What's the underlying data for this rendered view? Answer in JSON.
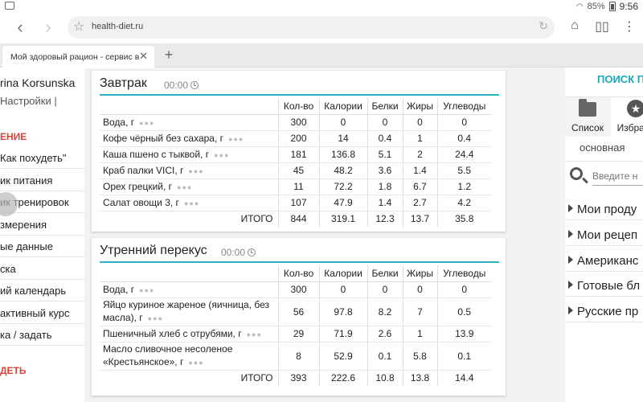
{
  "status": {
    "battery": "85%",
    "time": "9:56"
  },
  "browser": {
    "url": "health-diet.ru",
    "tab_title": "Мой здоровый рацион - сервис в...",
    "tab_close": "✕",
    "new_tab": "+"
  },
  "left": {
    "user": "rina Korsunska",
    "settings": "Настройки |",
    "section1": "ЕНИЕ",
    "items": [
      "Как похудеть\"",
      "ик питания",
      "ик тренировок",
      "змерения",
      "ые данные",
      "ска",
      "ий календарь",
      "активный курс",
      "ка / задать"
    ],
    "section2": "ДЕТЬ"
  },
  "table_headers": {
    "name": "",
    "qty": "Кол-во",
    "cal": "Калории",
    "prot": "Белки",
    "fat": "Жиры",
    "carb": "Углеводы"
  },
  "breakfast": {
    "title": "Завтрак",
    "time": "00:00",
    "rows": [
      {
        "name": "Вода, г",
        "qty": "300",
        "cal": "0",
        "prot": "0",
        "fat": "0",
        "carb": "0"
      },
      {
        "name": "Кофе чёрный без сахара, г",
        "qty": "200",
        "cal": "14",
        "prot": "0.4",
        "fat": "1",
        "carb": "0.4"
      },
      {
        "name": "Каша пшено с тыквой, г",
        "qty": "181",
        "cal": "136.8",
        "prot": "5.1",
        "fat": "2",
        "carb": "24.4"
      },
      {
        "name": "Краб палки VICI, г",
        "qty": "45",
        "cal": "48.2",
        "prot": "3.6",
        "fat": "1.4",
        "carb": "5.5"
      },
      {
        "name": "Орех грецкий, г",
        "qty": "11",
        "cal": "72.2",
        "prot": "1.8",
        "fat": "6.7",
        "carb": "1.2"
      },
      {
        "name": "Салат овощи 3, г",
        "qty": "107",
        "cal": "47.9",
        "prot": "1.4",
        "fat": "2.7",
        "carb": "4.2"
      }
    ],
    "total": {
      "label": "ИТОГО",
      "qty": "844",
      "cal": "319.1",
      "prot": "12.3",
      "fat": "13.7",
      "carb": "35.8"
    }
  },
  "snack": {
    "title": "Утренний перекус",
    "time": "00:00",
    "rows": [
      {
        "name": "Вода, г",
        "qty": "300",
        "cal": "0",
        "prot": "0",
        "fat": "0",
        "carb": "0"
      },
      {
        "name": "Яйцо куриное жареное (яичница, без масла), г",
        "qty": "56",
        "cal": "97.8",
        "prot": "8.2",
        "fat": "7",
        "carb": "0.5"
      },
      {
        "name": "Пшеничный хлеб с отрубями, г",
        "qty": "29",
        "cal": "71.9",
        "prot": "2.6",
        "fat": "1",
        "carb": "13.9"
      },
      {
        "name": "Масло сливочное несоленое «Крестьянское», г",
        "qty": "8",
        "cal": "52.9",
        "prot": "0.1",
        "fat": "5.8",
        "carb": "0.1"
      }
    ],
    "total": {
      "label": "ИТОГО",
      "qty": "393",
      "cal": "222.6",
      "prot": "10.8",
      "fat": "13.8",
      "carb": "14.4"
    }
  },
  "right": {
    "search_title": "ПОИСК П",
    "tab_list": "Список",
    "tab_fav": "Избран",
    "sub": "основная",
    "search_placeholder": "Введите н",
    "categories": [
      "Мои проду",
      "Мои рецеп",
      "Американс",
      "Готовые бл",
      "Русские пр"
    ]
  }
}
